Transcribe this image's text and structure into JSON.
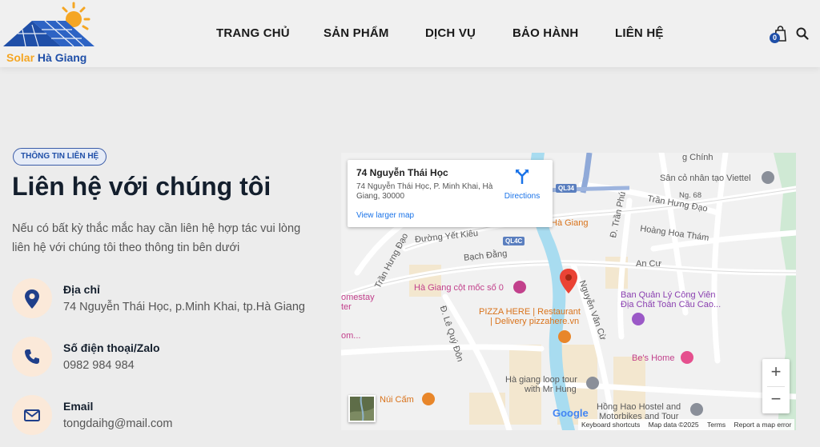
{
  "header": {
    "logo": {
      "word1": "Solar",
      "word2": "Hà Giang"
    },
    "nav": [
      {
        "label": "TRANG CHỦ"
      },
      {
        "label": "SẢN PHẨM"
      },
      {
        "label": "DỊCH VỤ"
      },
      {
        "label": "BẢO HÀNH"
      },
      {
        "label": "LIÊN HỆ"
      }
    ],
    "cart_count": "0",
    "icons": {
      "cart": "shopping-bag-icon",
      "search": "search-icon"
    }
  },
  "contact": {
    "badge": "THÔNG TIN LIÊN HỆ",
    "title": "Liên hệ với chúng tôi",
    "description": "Nếu có bất kỳ thắc mắc hay cần liên hệ hợp tác vui lòng liên hệ với chúng tôi theo thông tin bên dưới",
    "items": [
      {
        "icon": "location-pin-icon",
        "label": "Địa chỉ",
        "value": "74 Nguyễn Thái Học, p.Minh Khai, tp.Hà Giang"
      },
      {
        "icon": "phone-icon",
        "label": "Số điện thoại/Zalo",
        "value": "0982 984 984"
      },
      {
        "icon": "mail-icon",
        "label": "Email",
        "value": "tongdaihg@mail.com"
      }
    ]
  },
  "map": {
    "card": {
      "title": "74 Nguyễn Thái Học",
      "address": "74 Nguyễn Thái Học, P. Minh Khai, Hà Giang, 30000",
      "directions": "Directions",
      "larger_map": "View larger map"
    },
    "labels": {
      "chinh": "g Chính",
      "viettel": "Sân cỏ nhân tạo Viettel",
      "ng68": "Ng. 68",
      "tran_hung_dao_r": "Trần Hưng Đạo",
      "hoang_hoa_tham": "Hoàng Hoa Thám",
      "tran_phu": "Đ. Trần Phú",
      "ha_giang": "Hà Giang",
      "duong_yet_kieu": "Đường Yết Kiêu",
      "tran_hung_dao_l": "Trần Hưng Đạo",
      "bach_dang": "Bạch Đằng",
      "an_cu": "An Cư",
      "cot_moc": "Hà Giang cột mốc số 0",
      "nguyen_van_cu": "Nguyễn Văn Cừ",
      "homestay": "omestay",
      "ter": "ter",
      "ban_quan_ly1": "Ban Quản Lý Công Viên",
      "ban_quan_ly2": "Địa Chất Toàn Cầu Cao...",
      "le_quy_don": "Đ. Lê Quý Đôn",
      "pizza1": "PIZZA HERE | Restaurant",
      "pizza2": "| Delivery pizzahere.vn",
      "om": "om...",
      "bes_home": "Be's Home",
      "loop1": "Hà giang loop tour",
      "loop2": "with Mr Hung",
      "nui_cam": "Núi Cấm",
      "hong_hao1": "Hồng Hao Hostel and",
      "hong_hao2": "Motorbikes and Tour"
    },
    "shields": {
      "ql34": "QL34",
      "ql4c": "QL4C"
    },
    "zoom_in": "+",
    "zoom_out": "−",
    "google": "Google",
    "attribution": [
      "Keyboard shortcuts",
      "Map data ©2025",
      "Terms",
      "Report a map error"
    ]
  }
}
